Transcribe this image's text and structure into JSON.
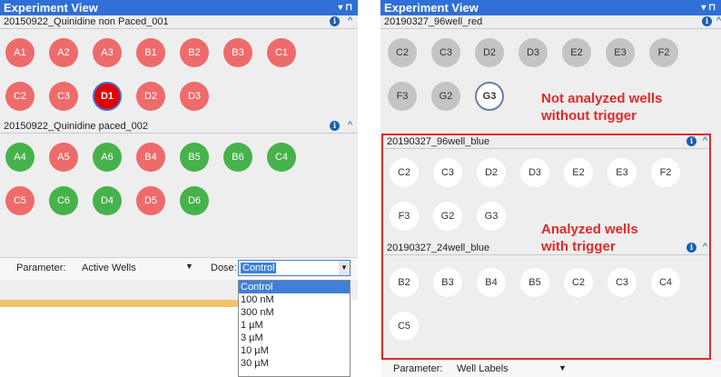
{
  "left": {
    "title": "Experiment View",
    "sections": [
      {
        "name": "20150922_Quinidine non Paced_001",
        "wells": [
          {
            "label": "A1",
            "color": "red"
          },
          {
            "label": "A2",
            "color": "red"
          },
          {
            "label": "A3",
            "color": "red"
          },
          {
            "label": "B1",
            "color": "red"
          },
          {
            "label": "B2",
            "color": "red"
          },
          {
            "label": "B3",
            "color": "red"
          },
          {
            "label": "C1",
            "color": "red"
          },
          {
            "label": "C2",
            "color": "red"
          },
          {
            "label": "C3",
            "color": "red"
          },
          {
            "label": "D1",
            "color": "selected"
          },
          {
            "label": "D2",
            "color": "red"
          },
          {
            "label": "D3",
            "color": "red"
          }
        ]
      },
      {
        "name": "20150922_Quinidine paced_002",
        "wells": [
          {
            "label": "A4",
            "color": "green"
          },
          {
            "label": "A5",
            "color": "red"
          },
          {
            "label": "A6",
            "color": "green"
          },
          {
            "label": "B4",
            "color": "red"
          },
          {
            "label": "B5",
            "color": "green"
          },
          {
            "label": "B6",
            "color": "green"
          },
          {
            "label": "C4",
            "color": "green"
          },
          {
            "label": "C5",
            "color": "red"
          },
          {
            "label": "C6",
            "color": "green"
          },
          {
            "label": "D4",
            "color": "green"
          },
          {
            "label": "D5",
            "color": "red"
          },
          {
            "label": "D6",
            "color": "green"
          }
        ]
      }
    ],
    "parameter_label": "Parameter:",
    "parameter_value": "Active Wells",
    "dose_label": "Dose:",
    "dose_value": "Control",
    "dose_options": [
      "Control",
      "100 nM",
      "300 nM",
      "1 µM",
      "3 µM",
      "10 µM",
      "30 µM"
    ]
  },
  "right": {
    "title": "Experiment View",
    "sections": [
      {
        "name": "20190327_96well_red",
        "wells": [
          {
            "label": "C2",
            "color": "grey"
          },
          {
            "label": "C3",
            "color": "grey"
          },
          {
            "label": "D2",
            "color": "grey"
          },
          {
            "label": "D3",
            "color": "grey"
          },
          {
            "label": "E2",
            "color": "grey"
          },
          {
            "label": "E3",
            "color": "grey"
          },
          {
            "label": "F2",
            "color": "grey"
          },
          {
            "label": "F3",
            "color": "grey"
          },
          {
            "label": "G2",
            "color": "grey"
          },
          {
            "label": "G3",
            "color": "selected-grey"
          }
        ]
      },
      {
        "name": "20190327_96well_blue",
        "wells": [
          {
            "label": "C2",
            "color": "white"
          },
          {
            "label": "C3",
            "color": "white"
          },
          {
            "label": "D2",
            "color": "white"
          },
          {
            "label": "D3",
            "color": "white"
          },
          {
            "label": "E2",
            "color": "white"
          },
          {
            "label": "E3",
            "color": "white"
          },
          {
            "label": "F2",
            "color": "white"
          },
          {
            "label": "F3",
            "color": "white"
          },
          {
            "label": "G2",
            "color": "white"
          },
          {
            "label": "G3",
            "color": "white"
          }
        ]
      },
      {
        "name": "20190327_24well_blue",
        "wells": [
          {
            "label": "B2",
            "color": "white"
          },
          {
            "label": "B3",
            "color": "white"
          },
          {
            "label": "B4",
            "color": "white"
          },
          {
            "label": "B5",
            "color": "white"
          },
          {
            "label": "C2",
            "color": "white"
          },
          {
            "label": "C3",
            "color": "white"
          },
          {
            "label": "C4",
            "color": "white"
          },
          {
            "label": "C5",
            "color": "white"
          }
        ]
      }
    ],
    "parameter_label": "Parameter:",
    "parameter_value": "Well Labels",
    "annotation_top": [
      "Not analyzed wells",
      "without trigger"
    ],
    "annotation_bottom": [
      "Analyzed wells",
      "with trigger"
    ]
  },
  "colors": {
    "title_bar": "#2f6fd6",
    "red_well": "#ee6b6b",
    "green_well": "#46b24b",
    "grey_well": "#c4c4c4",
    "highlight_box": "#e12929",
    "annotation": "#e12929"
  }
}
